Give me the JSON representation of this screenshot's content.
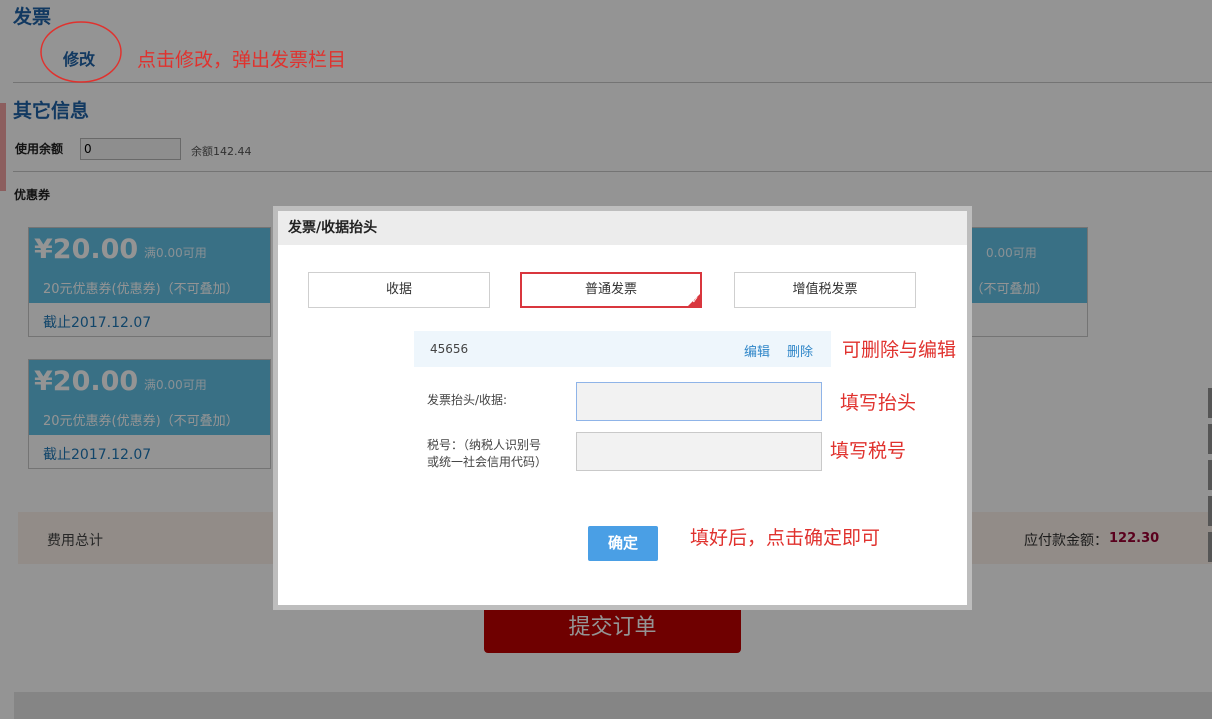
{
  "invoice_section": {
    "title": "发票",
    "modify_label": "修改"
  },
  "other_info": {
    "title": "其它信息",
    "balance_label": "使用余额",
    "balance_value": "0",
    "balance_hint": "余额142.44"
  },
  "coupons": {
    "title": "优惠券",
    "items": [
      {
        "amount": "¥20.00",
        "condition": "满0.00可用",
        "desc": "20元优惠券(优惠券)（不可叠加）",
        "expiry": "截止2017.12.07"
      },
      {
        "amount": "¥20.00",
        "condition": "满0.00可用",
        "desc": "20元优惠券(优惠券)（不可叠加）",
        "expiry": "截止2017.12.07"
      },
      {
        "condition": "0.00可用",
        "desc": "）（不可叠加）"
      }
    ]
  },
  "summary": {
    "label": "费用总计",
    "payable_label": "应付款金额：",
    "payable_value": "122.30"
  },
  "submit_label": "提交订单",
  "modal": {
    "title": "发票/收据抬头",
    "tabs": [
      {
        "label": "收据"
      },
      {
        "label": "普通发票",
        "active": true
      },
      {
        "label": "增值税发票"
      }
    ],
    "saved_header": {
      "name": "45656",
      "edit": "编辑",
      "delete": "删除"
    },
    "header_label": "发票抬头/收据:",
    "tax_label_1": "税号：（纳税人识别号",
    "tax_label_2": "或统一社会信用代码）",
    "confirm": "确定"
  },
  "annotations": {
    "modify": "点击修改，弹出发票栏目",
    "edit_delete": "可删除与编辑",
    "fill_header": "填写抬头",
    "fill_tax": "填写税号",
    "confirm_tip": "填好后，点击确定即可"
  },
  "colors": {
    "accent": "#1f63a8",
    "coupon": "#62c1e6",
    "annotation": "#e0322e",
    "submit": "#c00000",
    "confirm": "#4a9fe5",
    "price": "#9b0032"
  }
}
